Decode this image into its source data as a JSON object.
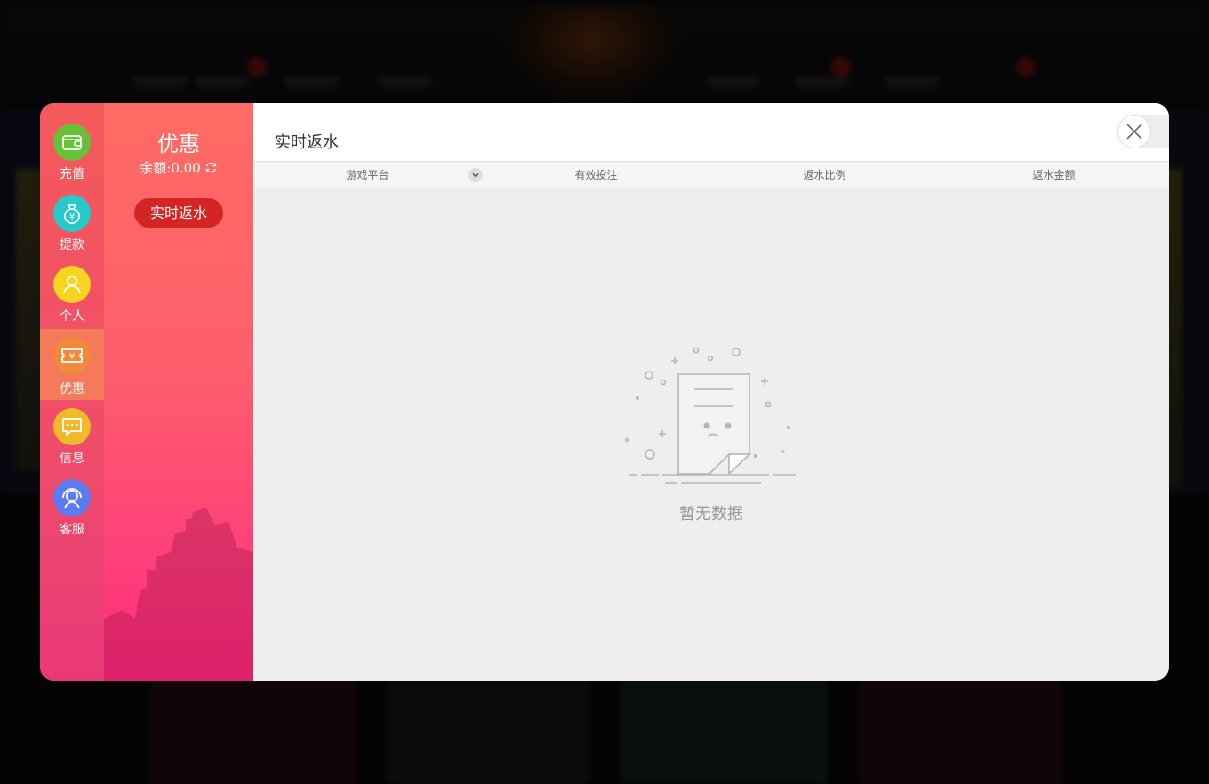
{
  "nav": {
    "items": [
      {
        "label": "充值",
        "icon": "wallet-icon",
        "color": "#67c23a"
      },
      {
        "label": "提款",
        "icon": "money-bag-icon",
        "color": "#27c8c8"
      },
      {
        "label": "个人",
        "icon": "user-icon",
        "color": "#f5d520"
      },
      {
        "label": "优惠",
        "icon": "ticket-yen-icon",
        "color": "#f08a3a",
        "active": true
      },
      {
        "label": "信息",
        "icon": "message-icon",
        "color": "#f0b92a"
      },
      {
        "label": "客服",
        "icon": "headset-icon",
        "color": "#5a7cf0"
      }
    ]
  },
  "side": {
    "title": "优惠",
    "balance": "余额:0.00",
    "button": "实时返水"
  },
  "content": {
    "title": "实时返水",
    "columns": [
      "游戏平台",
      "有效投注",
      "返水比例",
      "返水金额"
    ],
    "empty_text": "暂无数据"
  },
  "colors": {
    "active_button": "#d42525",
    "side_gradient_top": "#fe6b63",
    "side_gradient_bottom": "#ff2a7c"
  }
}
